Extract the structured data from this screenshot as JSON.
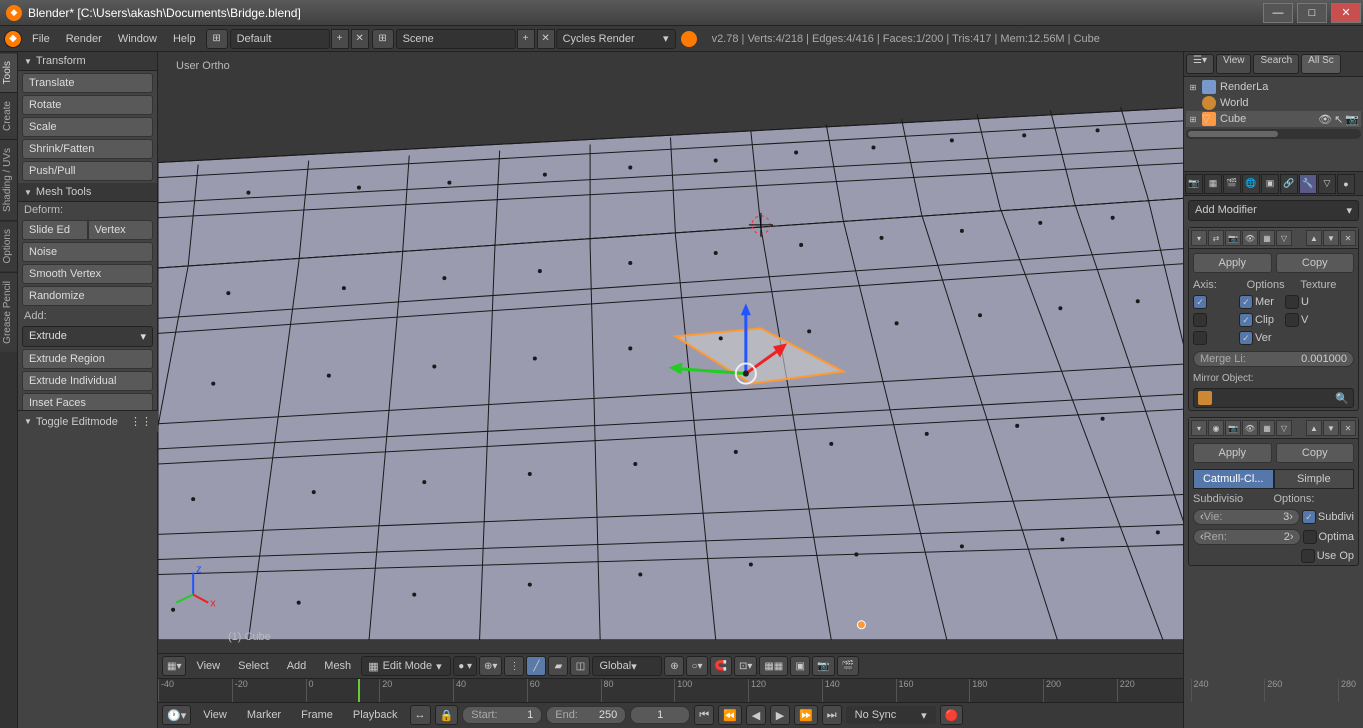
{
  "window": {
    "title": "Blender* [C:\\Users\\akash\\Documents\\Bridge.blend]"
  },
  "header": {
    "menus": [
      "File",
      "Render",
      "Window",
      "Help"
    ],
    "layout": "Default",
    "scene": "Scene",
    "engine": "Cycles Render",
    "stats": "v2.78 | Verts:4/218 | Edges:4/416 | Faces:1/200 | Tris:417 | Mem:12.56M | Cube"
  },
  "left_tabs": [
    "Tools",
    "Create",
    "Shading / UVs",
    "Options",
    "Grease Pencil"
  ],
  "tool_panel": {
    "transform_header": "Transform",
    "transform": [
      "Translate",
      "Rotate",
      "Scale",
      "Shrink/Fatten",
      "Push/Pull"
    ],
    "meshtools_header": "Mesh Tools",
    "deform_label": "Deform:",
    "deform_row": [
      "Slide Ed",
      "Vertex"
    ],
    "deform": [
      "Noise",
      "Smooth Vertex",
      "Randomize"
    ],
    "add_label": "Add:",
    "extrude_dropdown": "Extrude",
    "add": [
      "Extrude Region",
      "Extrude Individual",
      "Inset Faces"
    ],
    "operator": "Toggle Editmode"
  },
  "viewport": {
    "view_label": "User Ortho",
    "object_label": "(1) Cube"
  },
  "viewport_toolbar": {
    "menus": [
      "View",
      "Select",
      "Add",
      "Mesh"
    ],
    "mode": "Edit Mode",
    "orientation": "Global"
  },
  "timeline": {
    "ticks": [
      -40,
      -20,
      0,
      20,
      40,
      60,
      80,
      100,
      120,
      140,
      160,
      180,
      200,
      220,
      240,
      260,
      280
    ],
    "cursor_frame": 1,
    "menus": [
      "View",
      "Marker",
      "Frame",
      "Playback"
    ],
    "start_label": "Start:",
    "start_val": "1",
    "end_label": "End:",
    "end_val": "250",
    "frame_val": "1",
    "sync": "No Sync"
  },
  "right_header": {
    "view": "View",
    "search": "Search",
    "all": "All Sc"
  },
  "outliner": {
    "items": [
      {
        "label": "RenderLa",
        "icon": "#7799cc"
      },
      {
        "label": "World",
        "icon": "#cc8833"
      },
      {
        "label": "Cube",
        "icon": "#ff9944",
        "selected": true
      }
    ]
  },
  "props": {
    "add_modifier": "Add Modifier",
    "apply": "Apply",
    "copy": "Copy",
    "mirror": {
      "heads": [
        "Axis:",
        "Options",
        "Texture"
      ],
      "rows": [
        {
          "axis_on": true,
          "opt_on": true,
          "opt_label": "Mer",
          "tex_on": false,
          "tex_label": "U"
        },
        {
          "axis_on": false,
          "opt_on": true,
          "opt_label": "Clip",
          "tex_on": false,
          "tex_label": "V"
        },
        {
          "axis_on": false,
          "opt_on": true,
          "opt_label": "Ver",
          "tex_on": false,
          "tex_label": ""
        }
      ],
      "merge_label": "Merge Li:",
      "merge_val": "0.001000",
      "mirror_obj_label": "Mirror Object:"
    },
    "subsurf": {
      "type_a": "Catmull-Cl...",
      "type_b": "Simple",
      "subdiv_label": "Subdivisio",
      "options_label": "Options:",
      "view_label": "Vie:",
      "view_val": "3",
      "ren_label": "Ren:",
      "ren_val": "2",
      "opt1": "Subdivi",
      "opt2": "Optima",
      "opt3": "Use Op"
    }
  }
}
